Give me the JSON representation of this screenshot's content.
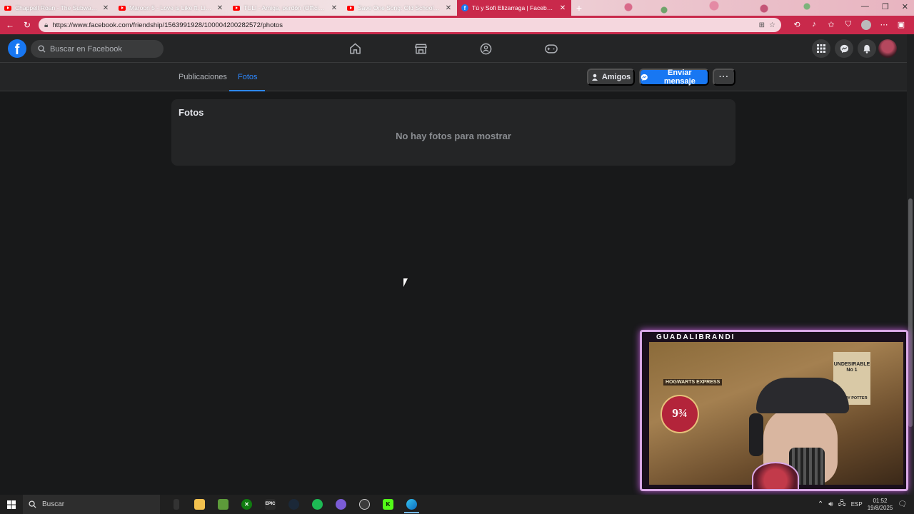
{
  "browser": {
    "tabs": [
      {
        "title": "Chappell Roan - The Subway (Offi",
        "icon": "youtube-icon",
        "active": false
      },
      {
        "title": "Maroon 5 - Love is Like ft. Lil Way",
        "icon": "youtube-icon",
        "active": false
      },
      {
        "title": "TULI - Amiga, perdón (Official Vi",
        "icon": "youtube-icon",
        "active": false
      },
      {
        "title": "Save One Song: Old School Editi",
        "icon": "youtube-icon",
        "active": false
      },
      {
        "title": "Tú y Sofi Elizarraga | Facebook",
        "icon": "facebook-icon",
        "active": true
      }
    ],
    "url": "https://www.facebook.com/friendship/1563991928/100004200282572/photos",
    "accent_color": "#c9294b"
  },
  "facebook": {
    "logo": "f",
    "search_placeholder": "Buscar en Facebook",
    "nav_icons": [
      "home-icon",
      "marketplace-icon",
      "groups-icon",
      "gaming-icon"
    ],
    "right_icons": [
      "menu-grid-icon",
      "messenger-icon",
      "notifications-icon"
    ],
    "subnav": {
      "tabs": [
        {
          "label": "Publicaciones",
          "active": false
        },
        {
          "label": "Fotos",
          "active": true
        }
      ],
      "friends_button": "Amigos",
      "message_button": "Enviar mensaje",
      "more_button": "···"
    },
    "photos_card": {
      "title": "Fotos",
      "empty_message": "No hay fotos para mostrar"
    }
  },
  "webcam": {
    "channel_name": "GUADALIBRANDI",
    "poster_text": "UNDESIRABLE\nNo 1",
    "poster_sub": "HARRY POTTER",
    "badge_label": "HOGWARTS EXPRESS",
    "badge_number": "9¾"
  },
  "taskbar": {
    "search_placeholder": "Buscar",
    "language": "ESP",
    "time": "01:52",
    "date": "19/8/2025"
  }
}
